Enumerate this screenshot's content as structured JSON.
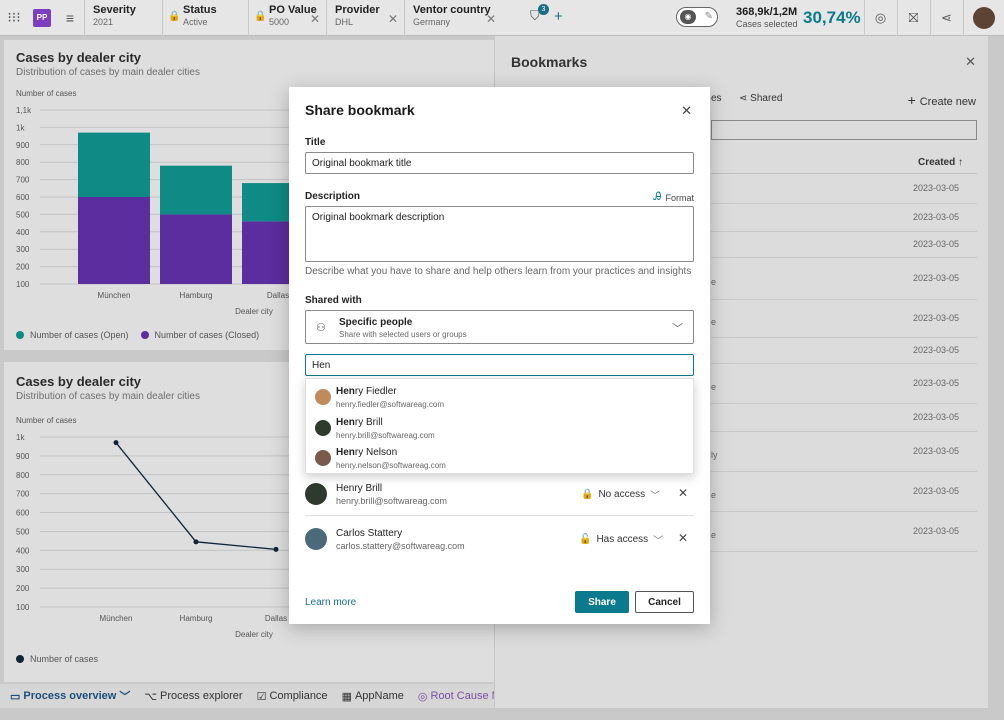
{
  "topbar": {
    "app_badge": "PP",
    "filters": [
      {
        "label": "Severity",
        "value": "2021"
      },
      {
        "label": "Status",
        "value": "Active"
      },
      {
        "label": "PO Value",
        "value": "5000"
      },
      {
        "label": "Provider",
        "value": "DHL"
      },
      {
        "label": "Ventor country",
        "value": "Germany"
      }
    ],
    "filter_badge": "3",
    "cases_count": "368,9k/1,2M",
    "cases_label": "Cases selected",
    "percentage": "30,74%"
  },
  "chart1": {
    "title": "Cases by dealer city",
    "subtitle": "Distribution of cases by main dealer cities",
    "legend": [
      "Number of cases (Open)",
      "Number of cases (Closed)"
    ]
  },
  "chart2": {
    "title": "Cases by dealer city",
    "subtitle": "Distribution of cases by main dealer cities",
    "legend": [
      "Number of cases"
    ]
  },
  "chart_data": [
    {
      "type": "bar",
      "ylabel": "Number of cases",
      "xlabel": "Dealer city",
      "yticks": [
        "1,1k",
        "1k",
        "900",
        "800",
        "700",
        "600",
        "500",
        "400",
        "300",
        "200",
        "100"
      ],
      "ylim": [
        0,
        1100
      ],
      "categories": [
        "München",
        "Hamburg",
        "Dallas"
      ],
      "stacked": true,
      "series": [
        {
          "name": "Number of cases (Closed)",
          "values": [
            500,
            400,
            360
          ],
          "color": "#5b2d9e"
        },
        {
          "name": "Number of cases (Open)",
          "values": [
            370,
            280,
            220
          ],
          "color": "#0f8a84"
        }
      ],
      "grid": true
    },
    {
      "type": "line",
      "ylabel": "Number of cases",
      "xlabel": "Dealer city",
      "yticks": [
        "1k",
        "900",
        "800",
        "700",
        "600",
        "500",
        "400",
        "300",
        "200",
        "100"
      ],
      "ylim": [
        0,
        1000
      ],
      "categories": [
        "München",
        "Hamburg",
        "Dallas"
      ],
      "series": [
        {
          "name": "Number of cases",
          "values": [
            970,
            445,
            405
          ],
          "color": "#10243a"
        }
      ],
      "grid": true
    }
  ],
  "tabs": [
    {
      "icon": "▭",
      "label": "Process overview",
      "suffix": "﹀"
    },
    {
      "icon": "⌥",
      "label": "Process explorer",
      "suffix": ""
    },
    {
      "icon": "☑",
      "label": "Compliance",
      "suffix": ""
    },
    {
      "icon": "▦",
      "label": "AppName",
      "suffix": ""
    },
    {
      "icon": "◎",
      "label": "Root Cause Miner",
      "suffix": "✕"
    }
  ],
  "bookmarks": {
    "title": "Bookmarks",
    "tab_fragment": "es",
    "tab_shared": "Shared",
    "create_new": "Create new",
    "created_header": "Created",
    "sort_arrow": "↑",
    "rows": [
      {
        "date": "2023-03-05",
        "frag": ""
      },
      {
        "date": "2023-03-05",
        "frag": ""
      },
      {
        "date": "2023-03-05",
        "frag": ""
      },
      {
        "date": "2023-03-05",
        "frag": "e"
      },
      {
        "date": "2023-03-05",
        "frag": "e"
      },
      {
        "date": "2023-03-05",
        "frag": ""
      },
      {
        "date": "2023-03-05",
        "frag": "e"
      },
      {
        "date": "2023-03-05",
        "frag": ""
      },
      {
        "date": "2023-03-05",
        "frag": "ly"
      },
      {
        "date": "2023-03-05",
        "frag": "e"
      },
      {
        "date": "2023-03-05",
        "frag": "e"
      }
    ]
  },
  "modal": {
    "title": "Share bookmark",
    "title_label": "Title",
    "title_value": "Original bookmark title",
    "description_label": "Description",
    "format_label": "Format",
    "description_value": "Original bookmark description",
    "description_help": "Describe what you have to share and help others learn from your practices and insights",
    "shared_with_label": "Shared with",
    "shared_option_title": "Specific people",
    "shared_option_sub": "Share with selected users or groups",
    "search_value": "Hen",
    "suggestions": [
      {
        "match": "Hen",
        "rest": "ry Fiedler",
        "email": "henry.fiedler@softwareag.com"
      },
      {
        "match": "Hen",
        "rest": "ry Brill",
        "email": "henry.brill@softwareag.com"
      },
      {
        "match": "Hen",
        "rest": "ry Nelson",
        "email": "henry.nelson@softwareag.com"
      }
    ],
    "people": [
      {
        "name": "Henry Brill",
        "email": "henry.brill@softwareag.com",
        "access": "No access"
      },
      {
        "name": "Carlos Stattery",
        "email": "carlos.stattery@softwareag.com",
        "access": "Has access"
      }
    ],
    "learn_more": "Learn more",
    "share_button": "Share",
    "cancel_button": "Cancel"
  }
}
